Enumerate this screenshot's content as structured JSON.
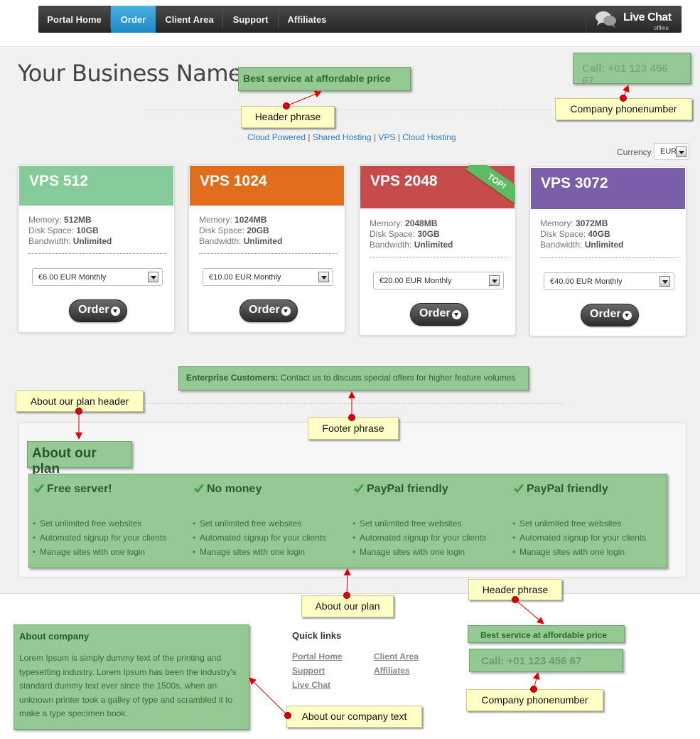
{
  "nav": {
    "items": [
      {
        "label": "Portal Home"
      },
      {
        "label": "Order"
      },
      {
        "label": "Client Area"
      },
      {
        "label": "Support"
      },
      {
        "label": "Affiliates"
      }
    ],
    "livechat_title": "Live Chat",
    "livechat_status": "offline"
  },
  "header": {
    "business_name": "Your Business Name",
    "tagline": "Best service at affordable price",
    "phone": "Call: +01 123 456 67"
  },
  "categories": [
    "Cloud Powered",
    "Shared Hosting",
    "VPS",
    "Cloud Hosting"
  ],
  "currency": {
    "label": "Currency",
    "value": "EUR"
  },
  "plans": [
    {
      "name": "VPS 512",
      "memory_label": "Memory:",
      "memory": "512MB",
      "disk_label": "Disk Space:",
      "disk": "10GB",
      "bw_label": "Bandwidth:",
      "bandwidth": "Unlimited",
      "price": "€6.00 EUR Monthly",
      "order": "Order",
      "color": "#86cb9a"
    },
    {
      "name": "VPS 1024",
      "memory_label": "Memory:",
      "memory": "1024MB",
      "disk_label": "Disk Space:",
      "disk": "20GB",
      "bw_label": "Bandwidth:",
      "bandwidth": "Unlimited",
      "price": "€10.00 EUR Monthly",
      "order": "Order",
      "color": "#e06e1c"
    },
    {
      "name": "VPS 2048",
      "memory_label": "Memory:",
      "memory": "2048MB",
      "disk_label": "Disk Space:",
      "disk": "30GB",
      "bw_label": "Bandwidth:",
      "bandwidth": "Unlimited",
      "price": "€20.00 EUR Monthly",
      "order": "Order",
      "color": "#c84b4b",
      "ribbon": "TOP!"
    },
    {
      "name": "VPS 3072",
      "memory_label": "Memory:",
      "memory": "3072MB",
      "disk_label": "Disk Space:",
      "disk": "40GB",
      "bw_label": "Bandwidth:",
      "bandwidth": "Unlimited",
      "price": "€40.00 EUR Monthly",
      "order": "Order",
      "color": "#7a5eaa"
    }
  ],
  "enterprise": {
    "bold": "Enterprise Customers:",
    "text": "Contact us to discuss special offers for higher feature volumes"
  },
  "about_plan": {
    "title": "About our plan",
    "features": [
      {
        "title": "Free server!",
        "items": [
          "Set unlimited free websites",
          "Automated signup for your clients",
          "Manage sites with one login"
        ]
      },
      {
        "title": "No money",
        "items": [
          "Set unlimited free websites",
          "Automated signup for your clients",
          "Manage sites with one login"
        ]
      },
      {
        "title": "PayPal friendly",
        "items": [
          "Set unlimited free websites",
          "Automated signup for your clients",
          "Manage sites with one login"
        ]
      },
      {
        "title": "PayPal friendly",
        "items": [
          "Set unlimited free websites",
          "Automated signup for your clients",
          "Manage sites with one login"
        ]
      }
    ]
  },
  "footer": {
    "about_title": "About company",
    "about_text": "Lorem Ipsum is simply dummy text of the printing and typesetting industry. Lorem Ipsum has been the industry's standard dummy text ever since the 1500s, when an unknown printer took a galley of type and scrambled it to make a type specimen book.",
    "quick_links_title": "Quick links",
    "links": [
      "Portal Home",
      "Client Area",
      "Support",
      "Affiliates",
      "Live Chat"
    ],
    "tagline": "Best service at affordable price",
    "phone": "Call: +01 123 456 67"
  },
  "callouts": {
    "header_phrase": "Header phrase",
    "company_phone": "Company phonenumber",
    "about_plan_header": "About our plan header",
    "footer_phrase": "Footer phrase",
    "about_plan": "About our plan",
    "footer_header_phrase": "Header phrase",
    "footer_company_phone": "Company phonenumber",
    "about_company_text": "About our company text"
  }
}
